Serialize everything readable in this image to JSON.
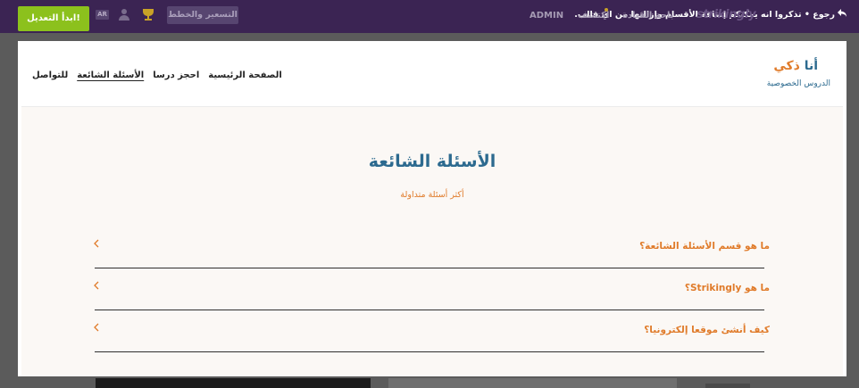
{
  "topbar": {
    "back_text": "رجوع • تذكروا انه يمكنكم إضافة الأقسام وإزالتها من اي قالب.",
    "brand": "strikingly",
    "dashboard": "باحة القيادة",
    "discover": "اكتشف",
    "admin": "ADMIN",
    "pricing": "التسعير والخطط",
    "lang": "AR",
    "edit_button": "ابدأ التعديل!"
  },
  "site": {
    "logo_part1": "أنا",
    "logo_part2": "ذكي",
    "tagline": "الدروس الخصوصية",
    "menu": [
      {
        "label": "الصفحة الرئيسية"
      },
      {
        "label": "احجز درسا"
      },
      {
        "label": "الأسئلة الشائعة"
      },
      {
        "label": "للتواصل"
      }
    ],
    "faq": {
      "title": "الأسئلة الشائعة",
      "subtitle": "أكثر أسئلة متداولة",
      "questions": [
        {
          "text": "ما هو قسم الأسئلة الشائعة؟"
        },
        {
          "text": "ما هو Strikingly؟"
        },
        {
          "text": "كيف أنشئ موقعا إلكترونيا؟"
        }
      ]
    }
  },
  "colors": {
    "topbar_bg": "#3b2453",
    "accent_orange": "#e07b2a",
    "title_blue": "#2c6a8f",
    "edit_green": "#8cc11d"
  }
}
